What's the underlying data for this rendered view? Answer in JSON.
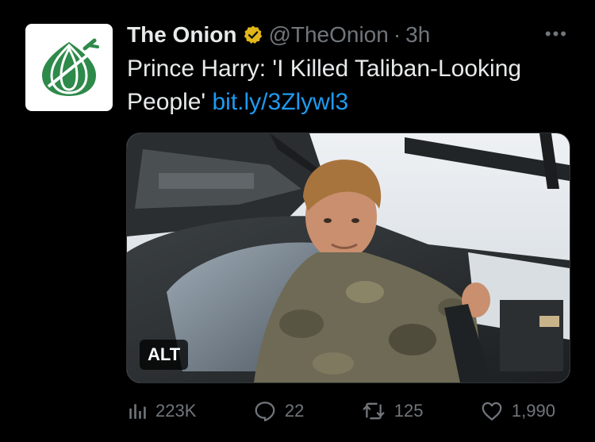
{
  "tweet": {
    "author_name": "The Onion",
    "handle": "@TheOnion",
    "separator": "·",
    "time": "3h",
    "more_label": "•••",
    "text": "Prince Harry: 'I Killed Taliban-Looking People' ",
    "link_text": "bit.ly/3Zlywl3",
    "media_alt_badge": "ALT",
    "icons": {
      "avatar": "onion-logo-icon",
      "verified": "verified-badge-icon",
      "views": "bar-chart-icon",
      "reply": "reply-icon",
      "retweet": "retweet-icon",
      "like": "heart-icon"
    }
  },
  "actions": {
    "views": "223K",
    "replies": "22",
    "retweets": "125",
    "likes": "1,990"
  },
  "colors": {
    "background": "#000000",
    "text": "#e7e9ea",
    "secondary": "#71767b",
    "link": "#1d9bf0",
    "brand_green": "#2e8a4a",
    "verified_gold": "#e2b719"
  }
}
